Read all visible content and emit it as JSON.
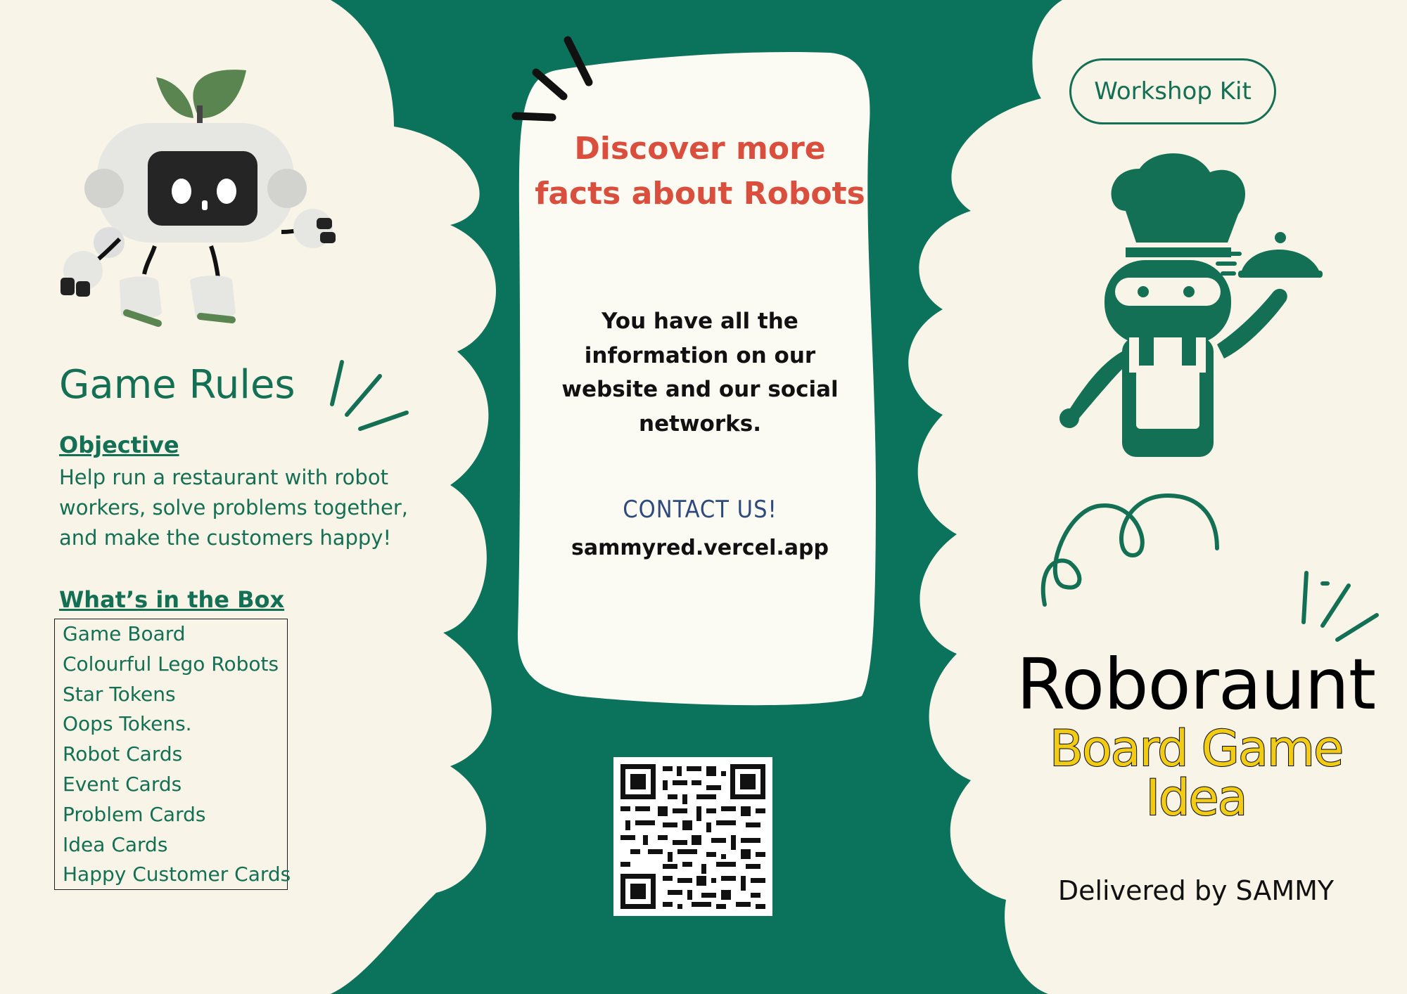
{
  "colors": {
    "brand_green": "#0b725b",
    "cream": "#f8f5e8",
    "accent_red": "#d94e3c",
    "title_yellow": "#f2cc14",
    "contact_blue": "#2e4a7d"
  },
  "left_panel": {
    "title": "Game Rules",
    "objective": {
      "heading": "Objective",
      "text": "Help run a restaurant with robot workers, solve problems together, and make the customers happy!"
    },
    "box": {
      "heading": "What’s in the Box",
      "items": [
        "Game Board",
        "Colourful Lego Robots",
        "Star Tokens",
        "Oops Tokens.",
        "Robot Cards",
        "Event Cards",
        "Problem Cards",
        "Idea Cards",
        "Happy Customer Cards"
      ]
    },
    "illustration_icon": "robot-with-sprout-icon"
  },
  "middle_panel": {
    "headline": "Discover more facts about Robots",
    "info": "You have all the information on our website and our social networks.",
    "contact_label": "CONTACT US!",
    "url": "sammyred.vercel.app",
    "qr_icon": "qr-code-icon"
  },
  "right_panel": {
    "badge": "Workshop Kit",
    "illustration_icon": "chef-robot-icon",
    "title": "Roboraunt",
    "subtitle_line1": "Board Game",
    "subtitle_line2": "Idea",
    "credit": "Delivered by SAMMY"
  }
}
